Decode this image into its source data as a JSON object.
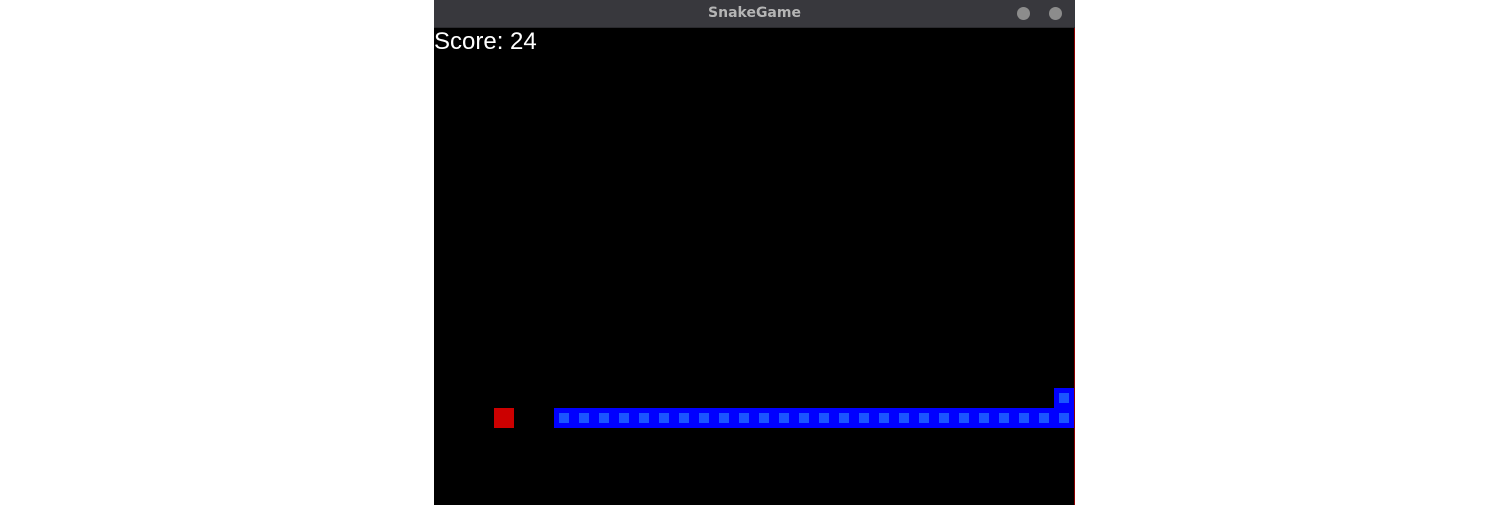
{
  "window": {
    "title": "SnakeGame"
  },
  "game": {
    "score_text": "Score: 24",
    "grid": {
      "cols": 32,
      "rows": 24
    },
    "food": {
      "col": 3,
      "row": 19
    },
    "snake": {
      "segments": [
        [
          31,
          18
        ],
        [
          31,
          19
        ],
        [
          30,
          19
        ],
        [
          29,
          19
        ],
        [
          28,
          19
        ],
        [
          27,
          19
        ],
        [
          26,
          19
        ],
        [
          25,
          19
        ],
        [
          24,
          19
        ],
        [
          23,
          19
        ],
        [
          22,
          19
        ],
        [
          21,
          19
        ],
        [
          20,
          19
        ],
        [
          19,
          19
        ],
        [
          18,
          19
        ],
        [
          17,
          19
        ],
        [
          16,
          19
        ],
        [
          15,
          19
        ],
        [
          14,
          19
        ],
        [
          13,
          19
        ],
        [
          12,
          19
        ],
        [
          11,
          19
        ],
        [
          10,
          19
        ],
        [
          9,
          19
        ],
        [
          8,
          19
        ],
        [
          7,
          19
        ],
        [
          6,
          19
        ]
      ]
    },
    "colors": {
      "background": "#000000",
      "snake_outer": "#0000ff",
      "snake_inner": "#1a55ff",
      "food": "#cc0000",
      "score_text": "#ffffff"
    }
  }
}
